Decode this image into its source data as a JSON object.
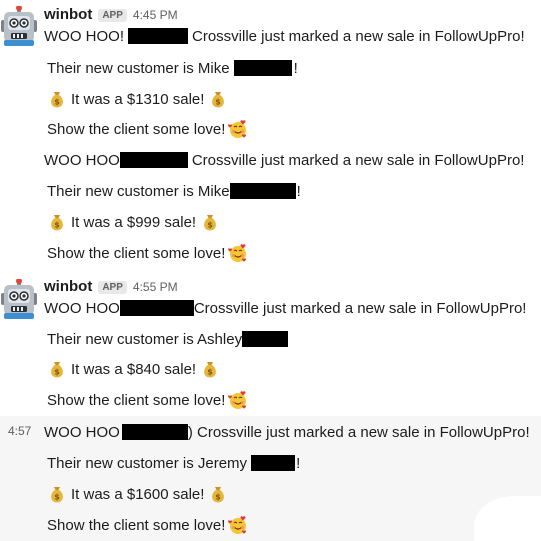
{
  "messages": [
    {
      "sender": {
        "name": "winbot",
        "badge": "APP",
        "time": "4:45 PM"
      },
      "lines": [
        {
          "pre": "WOO HOO!",
          "post": "Crossville just marked a new sale in FollowUpPro!"
        },
        {
          "pre": "Their new customer is Mike",
          "post": "!"
        },
        {
          "text": "It was a $1310 sale!"
        },
        {
          "text": "Show the client some love!"
        },
        {
          "pre": "WOO HOO",
          "post": "Crossville just marked a new sale in FollowUpPro!"
        },
        {
          "pre": "Their new customer is Mike",
          "post": "!"
        },
        {
          "text": "It was a $999 sale!"
        },
        {
          "text": "Show the client some love!"
        }
      ]
    },
    {
      "sender": {
        "name": "winbot",
        "badge": "APP",
        "time": "4:55 PM"
      },
      "lines": [
        {
          "pre": "WOO HOO",
          "post": "Crossville just marked a new sale in FollowUpPro!"
        },
        {
          "pre": "Their new customer is Ashley",
          "post": ""
        },
        {
          "text": "It was a $840 sale!"
        },
        {
          "text": "Show the client some love!"
        },
        {
          "pre": "WOO HOO",
          "post": ") Crossville just marked a new sale in FollowUpPro!"
        },
        {
          "pre": "Their new customer is Jeremy",
          "post": "!"
        },
        {
          "text": "It was a $1600 sale!"
        },
        {
          "text": "Show the client some love!"
        }
      ]
    }
  ],
  "hover_time": "4:57",
  "icons": {
    "avatar": "robot-icon",
    "money": "money-bag-icon",
    "love": "smiling-face-with-hearts-icon"
  },
  "colors": {
    "text": "#1d1c1d",
    "muted": "#616061",
    "hover_bg": "#f6f6f6",
    "redaction": "#000000"
  }
}
